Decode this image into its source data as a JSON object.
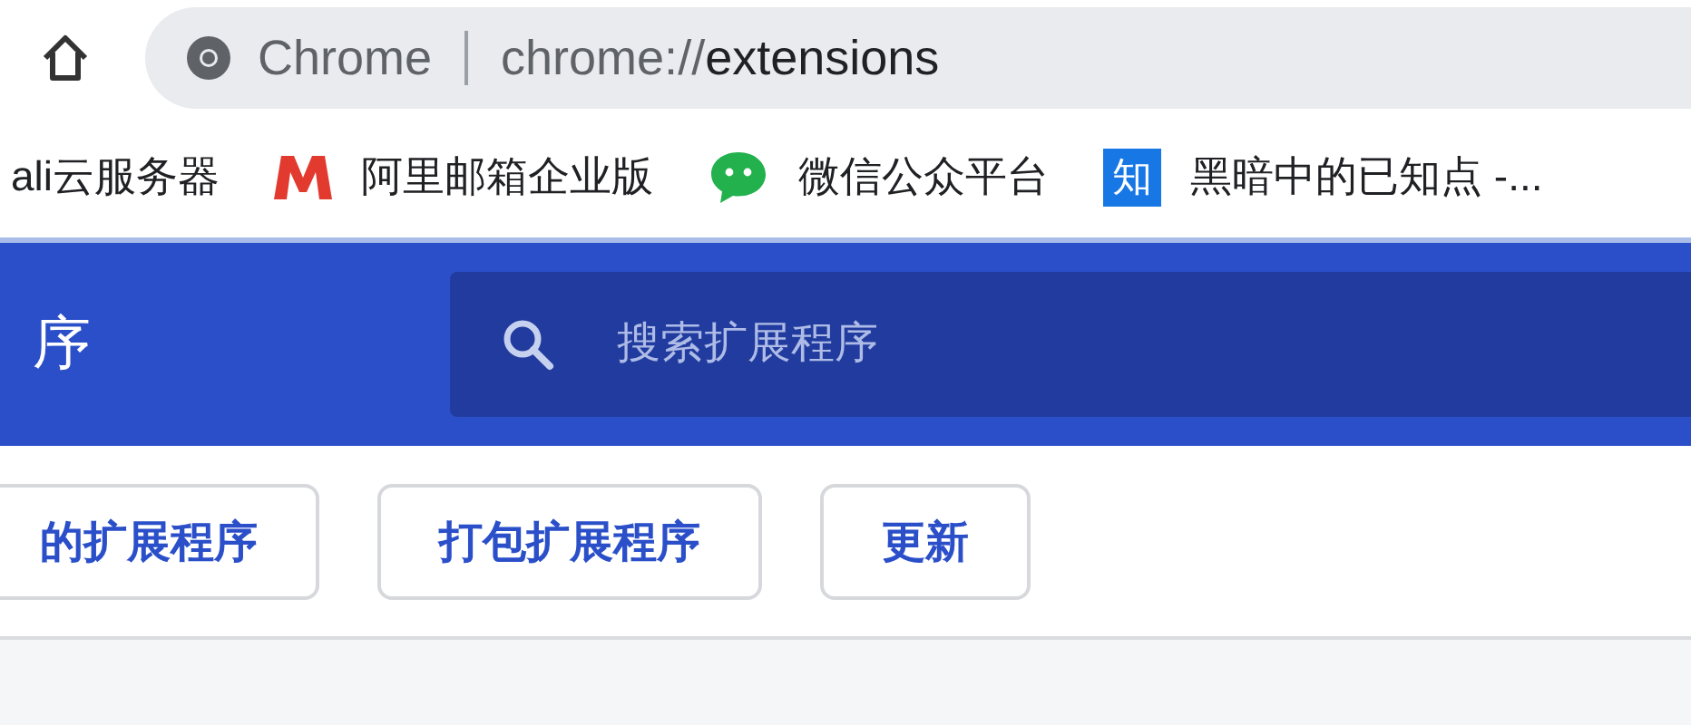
{
  "toolbar": {
    "omnibox": {
      "site": "Chrome",
      "url_prefix": "chrome://",
      "url_path": "extensions"
    }
  },
  "bookmarks": [
    {
      "label": "ali云服务器",
      "kind": "plain"
    },
    {
      "label": "阿里邮箱企业版",
      "kind": "mail"
    },
    {
      "label": "微信公众平台",
      "kind": "chat"
    },
    {
      "label": "黑暗中的已知点 -...",
      "kind": "zhi",
      "icon_text": "知"
    }
  ],
  "header": {
    "title": "序",
    "search": {
      "placeholder": "搜索扩展程序"
    }
  },
  "actions": [
    {
      "label": "的扩展程序"
    },
    {
      "label": "打包扩展程序"
    },
    {
      "label": "更新"
    }
  ]
}
